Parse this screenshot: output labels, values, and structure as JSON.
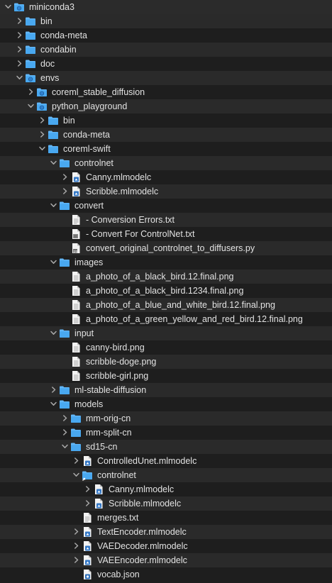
{
  "tree": [
    {
      "label": "miniconda3",
      "icon": "folder-doc-icon",
      "level": 0,
      "chevron": "down"
    },
    {
      "label": "bin",
      "icon": "folder-icon",
      "level": 1,
      "chevron": "right"
    },
    {
      "label": "conda-meta",
      "icon": "folder-icon",
      "level": 1,
      "chevron": "right"
    },
    {
      "label": "condabin",
      "icon": "folder-icon",
      "level": 1,
      "chevron": "right"
    },
    {
      "label": "doc",
      "icon": "folder-icon",
      "level": 1,
      "chevron": "right"
    },
    {
      "label": "envs",
      "icon": "folder-doc-icon",
      "level": 1,
      "chevron": "down"
    },
    {
      "label": "coreml_stable_diffusion",
      "icon": "folder-doc-icon",
      "level": 2,
      "chevron": "right"
    },
    {
      "label": "python_playground",
      "icon": "folder-doc-icon",
      "level": 2,
      "chevron": "down"
    },
    {
      "label": "bin",
      "icon": "folder-icon",
      "level": 3,
      "chevron": "right"
    },
    {
      "label": "conda-meta",
      "icon": "folder-icon",
      "level": 3,
      "chevron": "right"
    },
    {
      "label": "coreml-swift",
      "icon": "folder-icon",
      "level": 3,
      "chevron": "down"
    },
    {
      "label": "controlnet",
      "icon": "folder-icon",
      "level": 4,
      "chevron": "down"
    },
    {
      "label": "Canny.mlmodelc",
      "icon": "package-file-icon",
      "level": 5,
      "chevron": "right"
    },
    {
      "label": "Scribble.mlmodelc",
      "icon": "package-file-icon",
      "level": 5,
      "chevron": "right"
    },
    {
      "label": "convert",
      "icon": "folder-icon",
      "level": 4,
      "chevron": "down"
    },
    {
      "label": "- Conversion Errors.txt",
      "icon": "text-file-icon",
      "level": 5,
      "chevron": "none"
    },
    {
      "label": "- Convert For ControlNet.txt",
      "icon": "text-file-icon-dark",
      "level": 5,
      "chevron": "none"
    },
    {
      "label": "convert_original_controlnet_to_diffusers.py",
      "icon": "script-file-icon",
      "level": 5,
      "chevron": "none"
    },
    {
      "label": "images",
      "icon": "folder-icon",
      "level": 4,
      "chevron": "down"
    },
    {
      "label": "a_photo_of_a_black_bird.12.final.png",
      "icon": "image-file-icon",
      "level": 5,
      "chevron": "none"
    },
    {
      "label": "a_photo_of_a_black_bird.1234.final.png",
      "icon": "image-file-icon",
      "level": 5,
      "chevron": "none"
    },
    {
      "label": "a_photo_of_a_blue_and_white_bird.12.final.png",
      "icon": "image-file-icon",
      "level": 5,
      "chevron": "none"
    },
    {
      "label": "a_photo_of_a_green_yellow_and_red_bird.12.final.png",
      "icon": "image-file-icon",
      "level": 5,
      "chevron": "none"
    },
    {
      "label": "input",
      "icon": "folder-icon",
      "level": 4,
      "chevron": "down"
    },
    {
      "label": "canny-bird.png",
      "icon": "image-file-icon",
      "level": 5,
      "chevron": "none"
    },
    {
      "label": "scribble-doge.png",
      "icon": "image-file-icon",
      "level": 5,
      "chevron": "none"
    },
    {
      "label": "scribble-girl.png",
      "icon": "image-file-icon",
      "level": 5,
      "chevron": "none"
    },
    {
      "label": "ml-stable-diffusion",
      "icon": "folder-icon",
      "level": 4,
      "chevron": "right"
    },
    {
      "label": "models",
      "icon": "folder-icon",
      "level": 4,
      "chevron": "down"
    },
    {
      "label": "mm-orig-cn",
      "icon": "folder-icon",
      "level": 5,
      "chevron": "right"
    },
    {
      "label": "mm-split-cn",
      "icon": "folder-icon",
      "level": 5,
      "chevron": "right"
    },
    {
      "label": "sd15-cn",
      "icon": "folder-icon",
      "level": 5,
      "chevron": "down"
    },
    {
      "label": "ControlledUnet.mlmodelc",
      "icon": "package-file-icon",
      "level": 6,
      "chevron": "right"
    },
    {
      "label": "controlnet",
      "icon": "folder-alias-icon",
      "level": 6,
      "chevron": "down"
    },
    {
      "label": "Canny.mlmodelc",
      "icon": "package-file-icon",
      "level": 7,
      "chevron": "right"
    },
    {
      "label": "Scribble.mlmodelc",
      "icon": "package-file-icon",
      "level": 7,
      "chevron": "right"
    },
    {
      "label": "merges.txt",
      "icon": "text-file-icon",
      "level": 6,
      "chevron": "none"
    },
    {
      "label": "TextEncoder.mlmodelc",
      "icon": "package-file-icon",
      "level": 6,
      "chevron": "right"
    },
    {
      "label": "VAEDecoder.mlmodelc",
      "icon": "package-file-icon",
      "level": 6,
      "chevron": "right"
    },
    {
      "label": "VAEEncoder.mlmodelc",
      "icon": "package-file-icon",
      "level": 6,
      "chevron": "right"
    },
    {
      "label": "vocab.json",
      "icon": "json-file-icon",
      "level": 6,
      "chevron": "none"
    }
  ],
  "colors": {
    "folder": "#3d9ae8",
    "folder_tab": "#62b6f7",
    "folder_front": "#49a8f0",
    "doc_body": "#f3f3f3",
    "doc_fold": "#bdbdbd",
    "package_badge": "#3478c6",
    "chevron": "#a8a8a8",
    "row_stripe": "#2a2a2a",
    "row_base": "#1e1e1e"
  }
}
